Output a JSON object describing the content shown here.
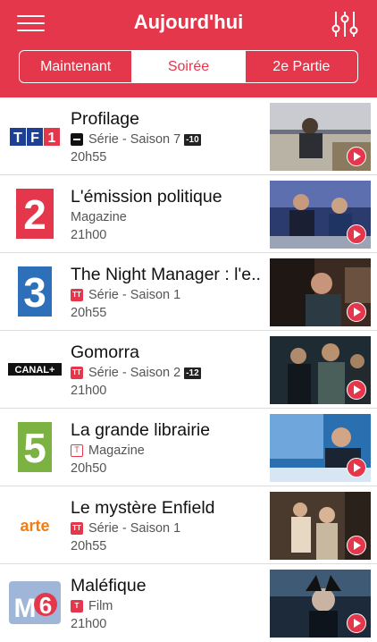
{
  "header": {
    "title": "Aujourd'hui",
    "menu_icon": "hamburger-menu-icon",
    "filter_icon": "sliders-filter-icon",
    "brand_color": "#e5374b"
  },
  "tabs": [
    {
      "label": "Maintenant",
      "active": false
    },
    {
      "label": "Soirée",
      "active": true
    },
    {
      "label": "2e Partie",
      "active": false
    }
  ],
  "programs": [
    {
      "channel": "TF1",
      "title": "Profilage",
      "category": "Série - Saison 7",
      "age_rating": "-10",
      "time": "20h55",
      "badge": "black"
    },
    {
      "channel": "France 2",
      "title": "L'émission politique",
      "category": "Magazine",
      "age_rating": "",
      "time": "21h00",
      "badge": ""
    },
    {
      "channel": "France 3",
      "title": "The Night Manager : l'e...",
      "category": "Série - Saison 1",
      "age_rating": "",
      "time": "20h55",
      "badge": "TT"
    },
    {
      "channel": "CANAL+",
      "title": "Gomorra",
      "category": "Série - Saison 2",
      "age_rating": "-12",
      "time": "21h00",
      "badge": "TT"
    },
    {
      "channel": "France 5",
      "title": "La grande librairie",
      "category": "Magazine",
      "age_rating": "",
      "time": "20h50",
      "badge": "T"
    },
    {
      "channel": "arte",
      "title": "Le mystère Enfield",
      "category": "Série - Saison 1",
      "age_rating": "",
      "time": "20h55",
      "badge": "TT"
    },
    {
      "channel": "M6",
      "title": "Maléfique",
      "category": "Film",
      "age_rating": "",
      "time": "21h00",
      "badge": "T"
    }
  ]
}
